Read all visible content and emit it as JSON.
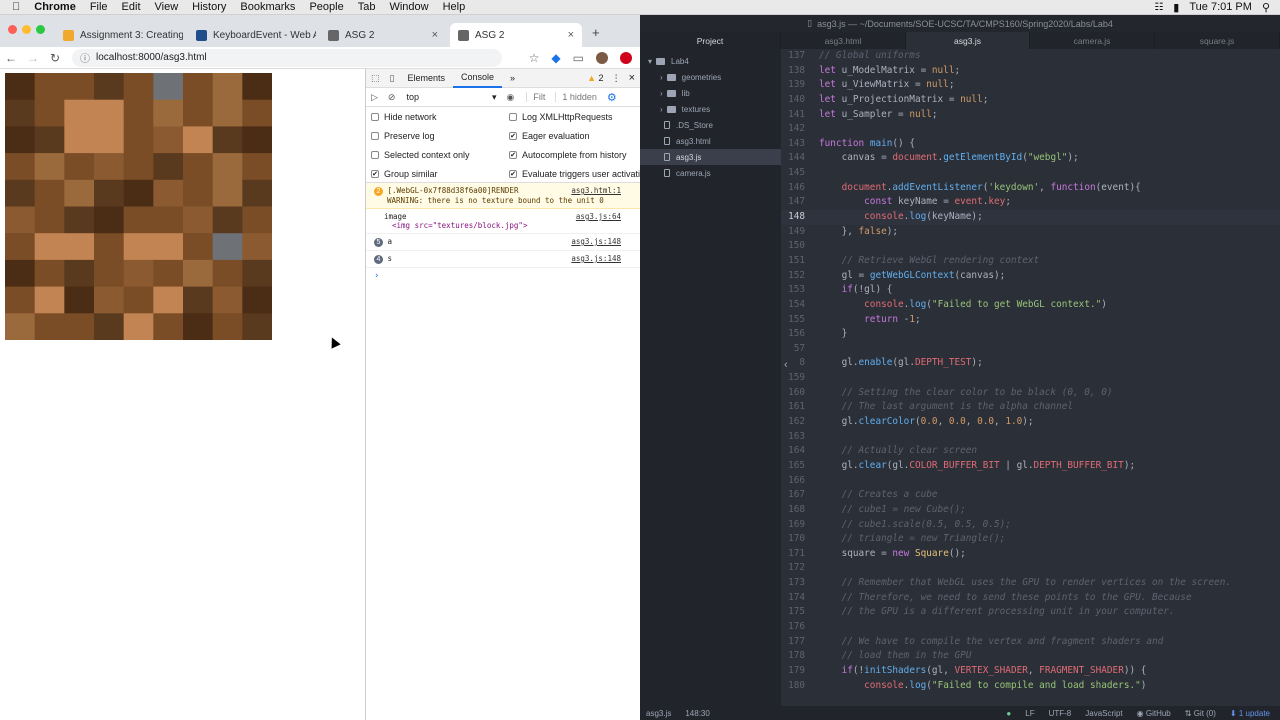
{
  "menubar": {
    "app": "Chrome",
    "items": [
      "File",
      "Edit",
      "View",
      "History",
      "Bookmarks",
      "People",
      "Tab",
      "Window",
      "Help"
    ],
    "clock": "Tue 7:01 PM"
  },
  "browser": {
    "tabs": [
      {
        "label": "Assignment 3: Creating",
        "favicon_color": "#f0a92e"
      },
      {
        "label": "KeyboardEvent - Web A",
        "favicon_color": "#1f4f8a"
      },
      {
        "label": "ASG 2",
        "favicon_color": "#666666"
      },
      {
        "label": "ASG 2",
        "favicon_color": "#666666"
      }
    ],
    "new_tab": "+",
    "url": "localhost:8000/asg3.html"
  },
  "canvas": {
    "texture_colors": [
      "#5a3a1e",
      "#7a4d26",
      "#9b6a3c",
      "#c28452",
      "#6e7176",
      "#4a2d14",
      "#8b5a30"
    ]
  },
  "devtools": {
    "tabs": [
      "Elements",
      "Console",
      "»"
    ],
    "active_tab": "Console",
    "warning_count": "2",
    "context": "top",
    "filter_placeholder": "Filt",
    "hidden_label": "1 hidden",
    "settings_left": [
      {
        "label": "Hide network",
        "checked": false
      },
      {
        "label": "Preserve log",
        "checked": false
      },
      {
        "label": "Selected context only",
        "checked": false
      },
      {
        "label": "Group similar",
        "checked": true
      }
    ],
    "settings_right": [
      {
        "label": "Log XMLHttpRequests",
        "checked": false
      },
      {
        "label": "Eager evaluation",
        "checked": true
      },
      {
        "label": "Autocomplete from history",
        "checked": true
      },
      {
        "label": "Evaluate triggers user activati",
        "checked": true
      }
    ],
    "messages": [
      {
        "type": "warning",
        "count": "2",
        "text": "[.WebGL-0x7f88d38f6a00]RENDER",
        "text2": "WARNING: there is no texture bound to the unit 0",
        "source": "asg3.html:1"
      },
      {
        "type": "log",
        "count": "",
        "text": "image",
        "text2": "<img src=\"textures/block.jpg\">",
        "source": "asg3.js:64"
      },
      {
        "type": "log",
        "count": "5",
        "text": "a",
        "text2": "",
        "source": "asg3.js:148"
      },
      {
        "type": "log",
        "count": "4",
        "text": "s",
        "text2": "",
        "source": "asg3.js:148"
      }
    ],
    "prompt": "›"
  },
  "editor": {
    "title": "asg3.js — ~/Documents/SOE-UCSC/TA/CMPS160/Spring2020/Labs/Lab4",
    "tabs": [
      "Project",
      "asg3.html",
      "asg3.js",
      "camera.js",
      "square.js"
    ],
    "active_tab": "asg3.js",
    "tree": [
      {
        "label": "Lab4",
        "kind": "folder",
        "depth": 0
      },
      {
        "label": "geometries",
        "kind": "folder",
        "depth": 1
      },
      {
        "label": "lib",
        "kind": "folder",
        "depth": 1
      },
      {
        "label": "textures",
        "kind": "folder",
        "depth": 1
      },
      {
        "label": ".DS_Store",
        "kind": "file",
        "depth": 1
      },
      {
        "label": "asg3.html",
        "kind": "file",
        "depth": 1
      },
      {
        "label": "asg3.js",
        "kind": "file",
        "depth": 1,
        "selected": true
      },
      {
        "label": "camera.js",
        "kind": "file",
        "depth": 1
      }
    ],
    "current_line": "148",
    "lines": [
      {
        "n": "137",
        "html": "<span class=\"cm\">// Global uniforms</span>"
      },
      {
        "n": "138",
        "html": "<span class=\"kw\">let</span> u_ModelMatrix = <span class=\"nm\">null</span>;"
      },
      {
        "n": "139",
        "html": "<span class=\"kw\">let</span> u_ViewMatrix = <span class=\"nm\">null</span>;"
      },
      {
        "n": "140",
        "html": "<span class=\"kw\">let</span> u_ProjectionMatrix = <span class=\"nm\">null</span>;"
      },
      {
        "n": "141",
        "html": "<span class=\"kw\">let</span> u_Sampler = <span class=\"nm\">null</span>;"
      },
      {
        "n": "142",
        "html": ""
      },
      {
        "n": "143",
        "html": "<span class=\"kw\">function</span> <span class=\"fn\">main</span>() {"
      },
      {
        "n": "144",
        "html": "    canvas = <span class=\"pr\">document</span>.<span class=\"fn\">getElementById</span>(<span class=\"st\">\"webgl\"</span>);"
      },
      {
        "n": "145",
        "html": ""
      },
      {
        "n": "146",
        "html": "    <span class=\"pr\">document</span>.<span class=\"fn\">addEventListener</span>(<span class=\"st\">'keydown'</span>, <span class=\"kw\">function</span>(event){"
      },
      {
        "n": "147",
        "html": "        <span class=\"kw\">const</span> keyName = <span class=\"pr\">event</span>.<span class=\"pr\">key</span>;"
      },
      {
        "n": "148",
        "html": "        <span class=\"pr\">console</span>.<span class=\"fn\">log</span>(keyName);"
      },
      {
        "n": "149",
        "html": "    }, <span class=\"nm\">false</span>);"
      },
      {
        "n": "150",
        "html": ""
      },
      {
        "n": "151",
        "html": "    <span class=\"cm\">// Retrieve WebGl rendering context</span>"
      },
      {
        "n": "152",
        "html": "    gl = <span class=\"fn\">getWebGLContext</span>(canvas);"
      },
      {
        "n": "153",
        "html": "    <span class=\"kw\">if</span>(!gl) {"
      },
      {
        "n": "154",
        "html": "        <span class=\"pr\">console</span>.<span class=\"fn\">log</span>(<span class=\"st\">\"Failed to get WebGL context.\"</span>)"
      },
      {
        "n": "155",
        "html": "        <span class=\"kw\">return</span> -<span class=\"nm\">1</span>;"
      },
      {
        "n": "156",
        "html": "    }"
      },
      {
        "n": "57",
        "html": ""
      },
      {
        "n": "8",
        "html": "    gl.<span class=\"fn\">enable</span>(gl.<span class=\"pr\">DEPTH_TEST</span>);"
      },
      {
        "n": "159",
        "html": ""
      },
      {
        "n": "160",
        "html": "    <span class=\"cm\">// Setting the clear color to be black (0, 0, 0)</span>"
      },
      {
        "n": "161",
        "html": "    <span class=\"cm\">// The last argument is the alpha channel</span>"
      },
      {
        "n": "162",
        "html": "    gl.<span class=\"fn\">clearColor</span>(<span class=\"nm\">0.0</span>, <span class=\"nm\">0.0</span>, <span class=\"nm\">0.0</span>, <span class=\"nm\">1.0</span>);"
      },
      {
        "n": "163",
        "html": ""
      },
      {
        "n": "164",
        "html": "    <span class=\"cm\">// Actually clear screen</span>"
      },
      {
        "n": "165",
        "html": "    gl.<span class=\"fn\">clear</span>(gl.<span class=\"pr\">COLOR_BUFFER_BIT</span> | gl.<span class=\"pr\">DEPTH_BUFFER_BIT</span>);"
      },
      {
        "n": "166",
        "html": ""
      },
      {
        "n": "167",
        "html": "    <span class=\"cm\">// Creates a cube</span>"
      },
      {
        "n": "168",
        "html": "    <span class=\"cm\">// cube1 = new Cube();</span>"
      },
      {
        "n": "169",
        "html": "    <span class=\"cm\">// cube1.scale(0.5, 0.5, 0.5);</span>"
      },
      {
        "n": "170",
        "html": "    <span class=\"cm\">// triangle = new Triangle();</span>"
      },
      {
        "n": "171",
        "html": "    square = <span class=\"kw\">new</span> <span class=\"cn\">Square</span>();"
      },
      {
        "n": "172",
        "html": ""
      },
      {
        "n": "173",
        "html": "    <span class=\"cm\">// Remember that WebGL uses the GPU to render vertices on the screen.</span>"
      },
      {
        "n": "174",
        "html": "    <span class=\"cm\">// Therefore, we need to send these points to the GPU. Because</span>"
      },
      {
        "n": "175",
        "html": "    <span class=\"cm\">// the GPU is a different processing unit in your computer.</span>"
      },
      {
        "n": "176",
        "html": ""
      },
      {
        "n": "177",
        "html": "    <span class=\"cm\">// We have to compile the vertex and fragment shaders and</span>"
      },
      {
        "n": "178",
        "html": "    <span class=\"cm\">// load them in the GPU</span>"
      },
      {
        "n": "179",
        "html": "    <span class=\"kw\">if</span>(!<span class=\"fn\">initShaders</span>(gl, <span class=\"pr\">VERTEX_SHADER</span>, <span class=\"pr\">FRAGMENT_SHADER</span>)) {"
      },
      {
        "n": "180",
        "html": "        <span class=\"pr\">console</span>.<span class=\"fn\">log</span>(<span class=\"st\">\"Failed to compile and load shaders.\"</span>)"
      }
    ],
    "status_left": [
      "asg3.js",
      "148:30"
    ],
    "status_right": [
      "LF",
      "UTF-8",
      "JavaScript",
      "GitHub",
      "Git (0)",
      "1 update"
    ]
  }
}
